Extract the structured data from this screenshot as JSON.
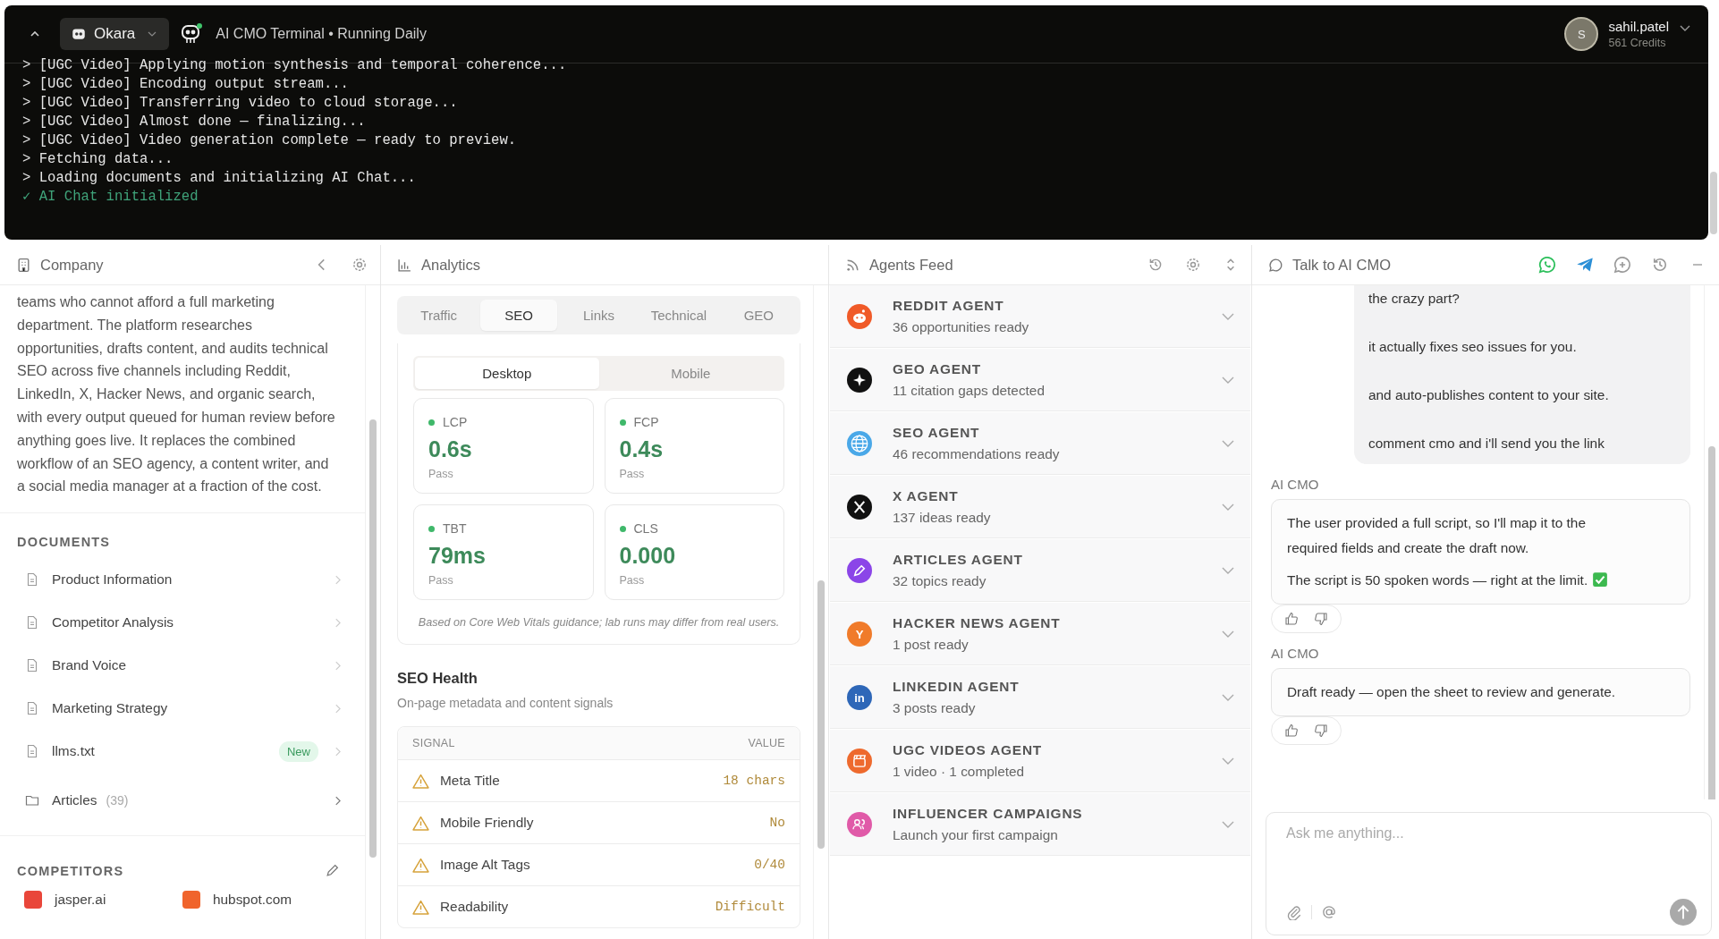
{
  "topbar": {
    "workspace": "Okara",
    "title": "AI CMO Terminal • Running Daily",
    "user": {
      "initial": "S",
      "name": "sahil.patel",
      "credits": "561 Credits"
    }
  },
  "terminal": {
    "lines": [
      {
        "kind": "log",
        "text": "> [UGC Video] Applying motion synthesis and temporal coherence..."
      },
      {
        "kind": "log",
        "text": "> [UGC Video] Encoding output stream..."
      },
      {
        "kind": "log",
        "text": "> [UGC Video] Transferring video to cloud storage..."
      },
      {
        "kind": "log",
        "text": "> [UGC Video] Almost done — finalizing..."
      },
      {
        "kind": "log",
        "text": "> [UGC Video] Video generation complete — ready to preview."
      },
      {
        "kind": "log",
        "text": "> Fetching data..."
      },
      {
        "kind": "log",
        "text": "> Loading documents and initializing AI Chat..."
      },
      {
        "kind": "success",
        "text": "✓ AI Chat initialized"
      }
    ]
  },
  "company": {
    "title": "Company",
    "description": "teams who cannot afford a full marketing department. The platform researches opportunities, drafts content, and audits technical SEO across five channels including Reddit, LinkedIn, X, Hacker News, and organic search, with every output queued for human review before anything goes live. It replaces the combined workflow of an SEO agency, a content writer, and a social media manager at a fraction of the cost.",
    "documents_heading": "DOCUMENTS",
    "documents": [
      {
        "kind": "file",
        "name": "Product Information"
      },
      {
        "kind": "file",
        "name": "Competitor Analysis"
      },
      {
        "kind": "file",
        "name": "Brand Voice"
      },
      {
        "kind": "file",
        "name": "Marketing Strategy"
      },
      {
        "kind": "file",
        "name": "llms.txt",
        "badge": "New"
      },
      {
        "kind": "folder",
        "name": "Articles",
        "count": "(39)"
      }
    ],
    "competitors_heading": "COMPETITORS",
    "competitors": [
      {
        "name": "jasper.ai",
        "color": "#e9463a"
      },
      {
        "name": "hubspot.com",
        "color": "#f0642c"
      }
    ]
  },
  "analytics": {
    "title": "Analytics",
    "tabs": [
      {
        "label": "Traffic",
        "selected": false
      },
      {
        "label": "SEO",
        "selected": true
      },
      {
        "label": "Links",
        "selected": false
      },
      {
        "label": "Technical",
        "selected": false
      },
      {
        "label": "GEO",
        "selected": false
      }
    ],
    "device_tabs": [
      {
        "label": "Desktop",
        "selected": true
      },
      {
        "label": "Mobile",
        "selected": false
      }
    ],
    "metrics": [
      {
        "label": "LCP",
        "value": "0.6s",
        "status": "Pass",
        "color": "#3fb86a"
      },
      {
        "label": "FCP",
        "value": "0.4s",
        "status": "Pass",
        "color": "#3fb86a"
      },
      {
        "label": "TBT",
        "value": "79ms",
        "status": "Pass",
        "color": "#3fb86a"
      },
      {
        "label": "CLS",
        "value": "0.000",
        "status": "Pass",
        "color": "#3fb86a"
      }
    ],
    "note": "Based on Core Web Vitals guidance; lab runs may differ from real users.",
    "seo_health": {
      "title": "SEO Health",
      "subtitle": "On-page metadata and content signals",
      "columns": [
        "SIGNAL",
        "VALUE"
      ],
      "rows": [
        {
          "signal": "Meta Title",
          "value": "18 chars"
        },
        {
          "signal": "Mobile Friendly",
          "value": "No"
        },
        {
          "signal": "Image Alt Tags",
          "value": "0/40"
        },
        {
          "signal": "Readability",
          "value": "Difficult"
        }
      ]
    }
  },
  "agents_feed": {
    "title": "Agents Feed",
    "agents": [
      {
        "kind": "reddit",
        "name": "REDDIT AGENT",
        "summary": "36 opportunities ready",
        "color": "#f05a28"
      },
      {
        "kind": "sparkle",
        "name": "GEO AGENT",
        "summary": "11 citation gaps detected",
        "color": "#111111"
      },
      {
        "kind": "globe",
        "name": "SEO AGENT",
        "summary": "46 recommendations ready",
        "color": "#4aa8e8"
      },
      {
        "kind": "x",
        "name": "X AGENT",
        "summary": "137 ideas ready",
        "color": "#111111"
      },
      {
        "kind": "pen",
        "name": "ARTICLES AGENT",
        "summary": "32 topics ready",
        "color": "#8b45e8"
      },
      {
        "kind": "glyph",
        "glyph": "Y",
        "name": "HACKER NEWS AGENT",
        "summary": "1 post ready",
        "color": "#f07b2a"
      },
      {
        "kind": "glyph",
        "glyph": "in",
        "name": "LINKEDIN AGENT",
        "summary": "3 posts ready",
        "color": "#2e67b8"
      },
      {
        "kind": "clapper",
        "name": "UGC VIDEOS AGENT",
        "summary": "1 video · 1 completed",
        "color": "#ee6a2e"
      },
      {
        "kind": "people",
        "name": "INFLUENCER CAMPAIGNS",
        "summary": "Launch your first campaign",
        "color": "#e05aa8"
      }
    ]
  },
  "chat": {
    "title": "Talk to AI CMO",
    "messages": [
      {
        "kind": "user",
        "paragraphs": [
          {
            "text": "the crazy part?"
          },
          {
            "text": "it actually fixes seo issues for you."
          },
          {
            "text": "and auto-publishes content to your site."
          },
          {
            "text": "comment cmo and i'll send you the link"
          }
        ]
      },
      {
        "kind": "assistant",
        "sender": "AI CMO",
        "paragraphs": [
          {
            "text": "The user provided a full script, so I'll map it to the required fields and create the draft now."
          },
          {
            "text": "The script is 50 spoken words — right at the limit.",
            "check": true
          }
        ]
      },
      {
        "kind": "assistant",
        "sender": "AI CMO",
        "paragraphs": [
          {
            "text": "Draft ready — open the sheet to review and generate."
          }
        ]
      }
    ],
    "input": {
      "placeholder": "Ask me anything..."
    }
  }
}
